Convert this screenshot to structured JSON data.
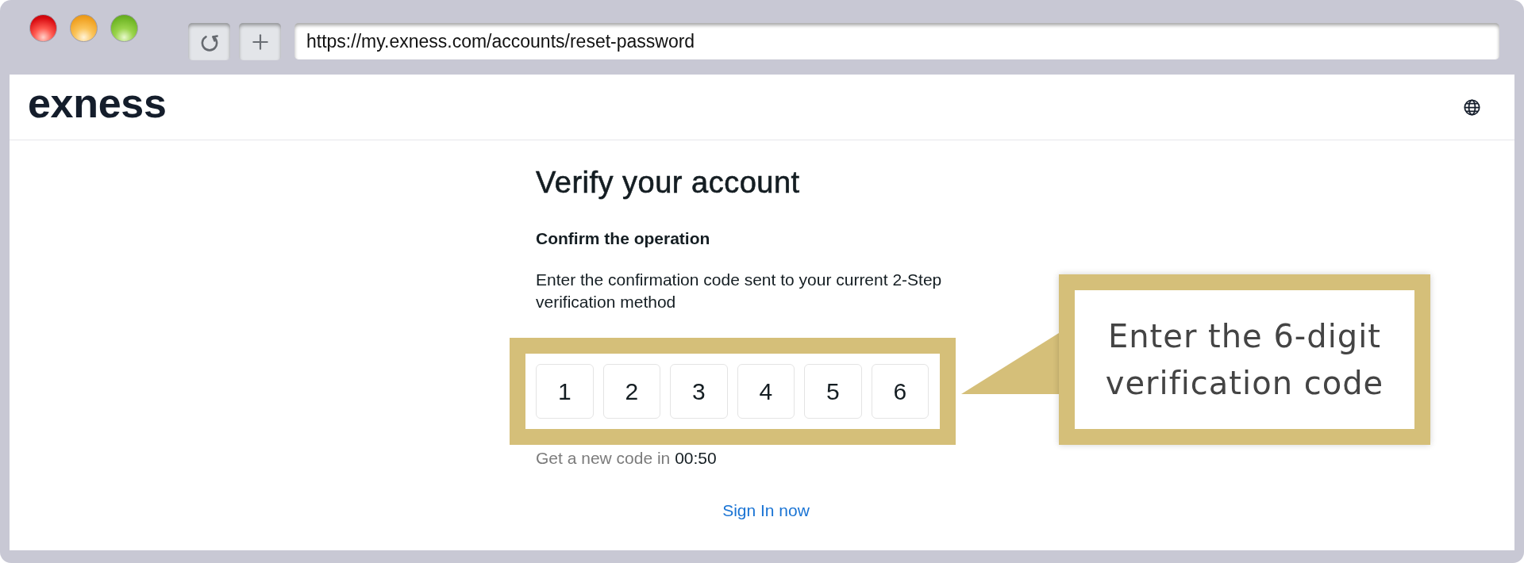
{
  "browser": {
    "address_bar": {
      "value": "https://my.exness.com/accounts/reset-password"
    }
  },
  "header": {
    "logo": "exness"
  },
  "verify": {
    "title": "Verify your account",
    "subtitle": "Confirm the operation",
    "instructions": "Enter the confirmation code sent to your current 2-Step verification method",
    "code_digits": [
      "1",
      "2",
      "3",
      "4",
      "5",
      "6"
    ],
    "resend": {
      "label": "Get a new code in",
      "countdown": "00:50"
    },
    "sign_in_link": "Sign In now"
  },
  "callout": {
    "text": "Enter the 6-digit verification code"
  }
}
